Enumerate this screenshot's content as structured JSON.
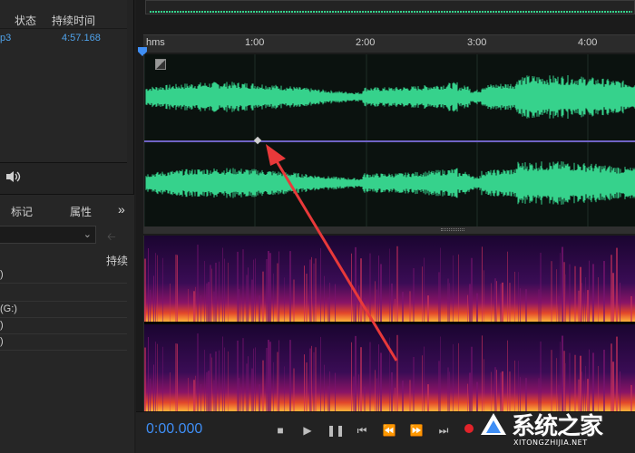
{
  "files_panel": {
    "col_status": "状态",
    "col_duration": "持续时间",
    "file": {
      "name_fragment": "p3",
      "duration": "4:57.168"
    }
  },
  "props_panel": {
    "tabs": [
      "标记",
      "属性",
      "»"
    ],
    "column_header": "持续",
    "rows": [
      ")",
      ")",
      "(G:)",
      ")",
      ")"
    ]
  },
  "ruler": {
    "labels": [
      "hms",
      "1:00",
      "2:00",
      "3:00",
      "4:00"
    ]
  },
  "transport": {
    "timecode": "0:00.000",
    "buttons": [
      "stop",
      "play",
      "pause",
      "go-to-start",
      "rewind",
      "fast-forward",
      "go-to-end",
      "record"
    ]
  },
  "watermark": {
    "brand": "系统之家",
    "url": "XITONGZHIJIA.NET"
  },
  "colors": {
    "waveform": "#36d28c",
    "timecode": "#3f8ef5",
    "file_text": "#4fa2ea",
    "volume_line": "#6f63c4",
    "arrow": "#e8393a",
    "record": "#e2232a"
  },
  "icons": [
    "speaker-icon",
    "snap-toggle-icon",
    "playhead-marker-icon",
    "chevron-down-icon",
    "back-arrow-icon"
  ]
}
